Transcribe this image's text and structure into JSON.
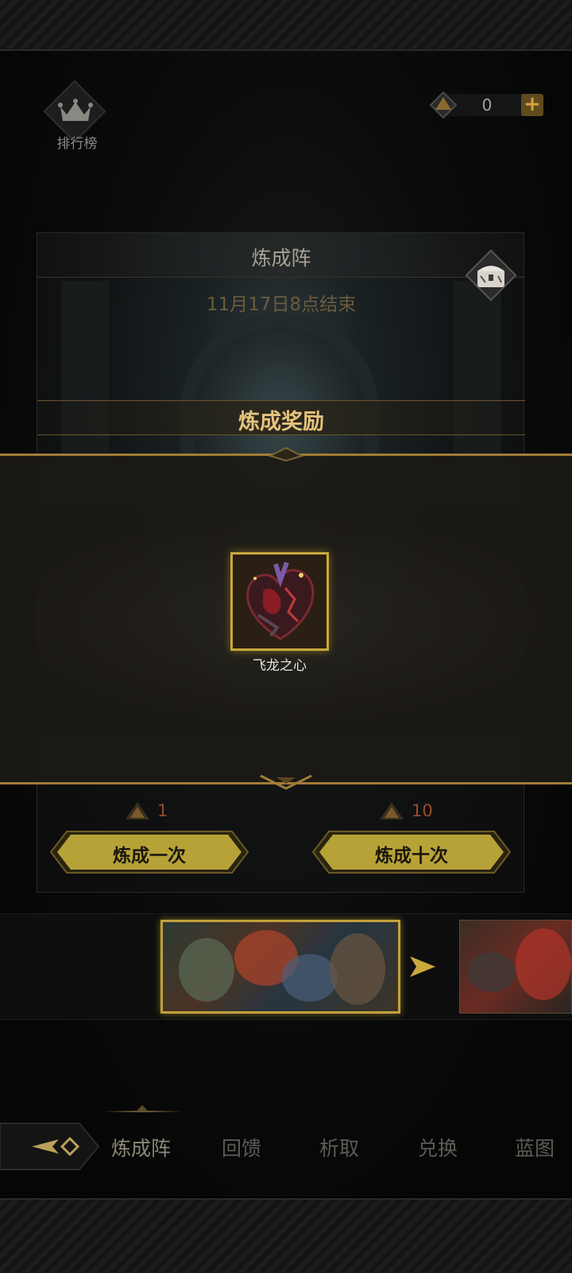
{
  "header": {
    "ranking_label": "排行榜",
    "currency_value": "0"
  },
  "panel": {
    "title": "炼成阵",
    "end_time": "11月17日8点结束",
    "reward_title": "炼成奖励"
  },
  "reward": {
    "item_name": "飞龙之心",
    "icon": "dragon-heart-icon"
  },
  "actions": {
    "single": {
      "cost": "1",
      "label": "炼成一次"
    },
    "ten": {
      "cost": "10",
      "label": "炼成十次"
    }
  },
  "nav": {
    "tabs": [
      "炼成阵",
      "回馈",
      "析取",
      "兑换",
      "蓝图"
    ],
    "active_index": 0
  },
  "colors": {
    "gold_accent": "#c9a83c",
    "title_gold": "#e6c27a",
    "cost_red": "#9a4b2e"
  }
}
